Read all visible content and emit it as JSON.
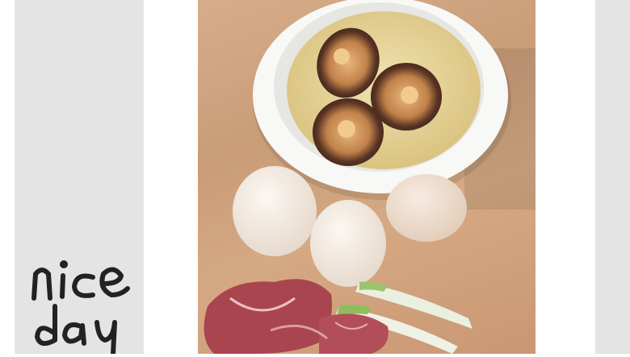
{
  "caption": {
    "line1": "nice",
    "line2": "day"
  },
  "photo": {
    "subject": [
      "mushrooms-in-bowl",
      "eggs",
      "pork",
      "green-onion"
    ]
  },
  "colors": {
    "panel": "#e4e4e4",
    "board": "#d1a47e",
    "bowl": "#f8f8f6",
    "egg": "#f2ebe4",
    "meat": "#a9454f",
    "onion_green": "#9ac46b",
    "ink": "#222222"
  }
}
